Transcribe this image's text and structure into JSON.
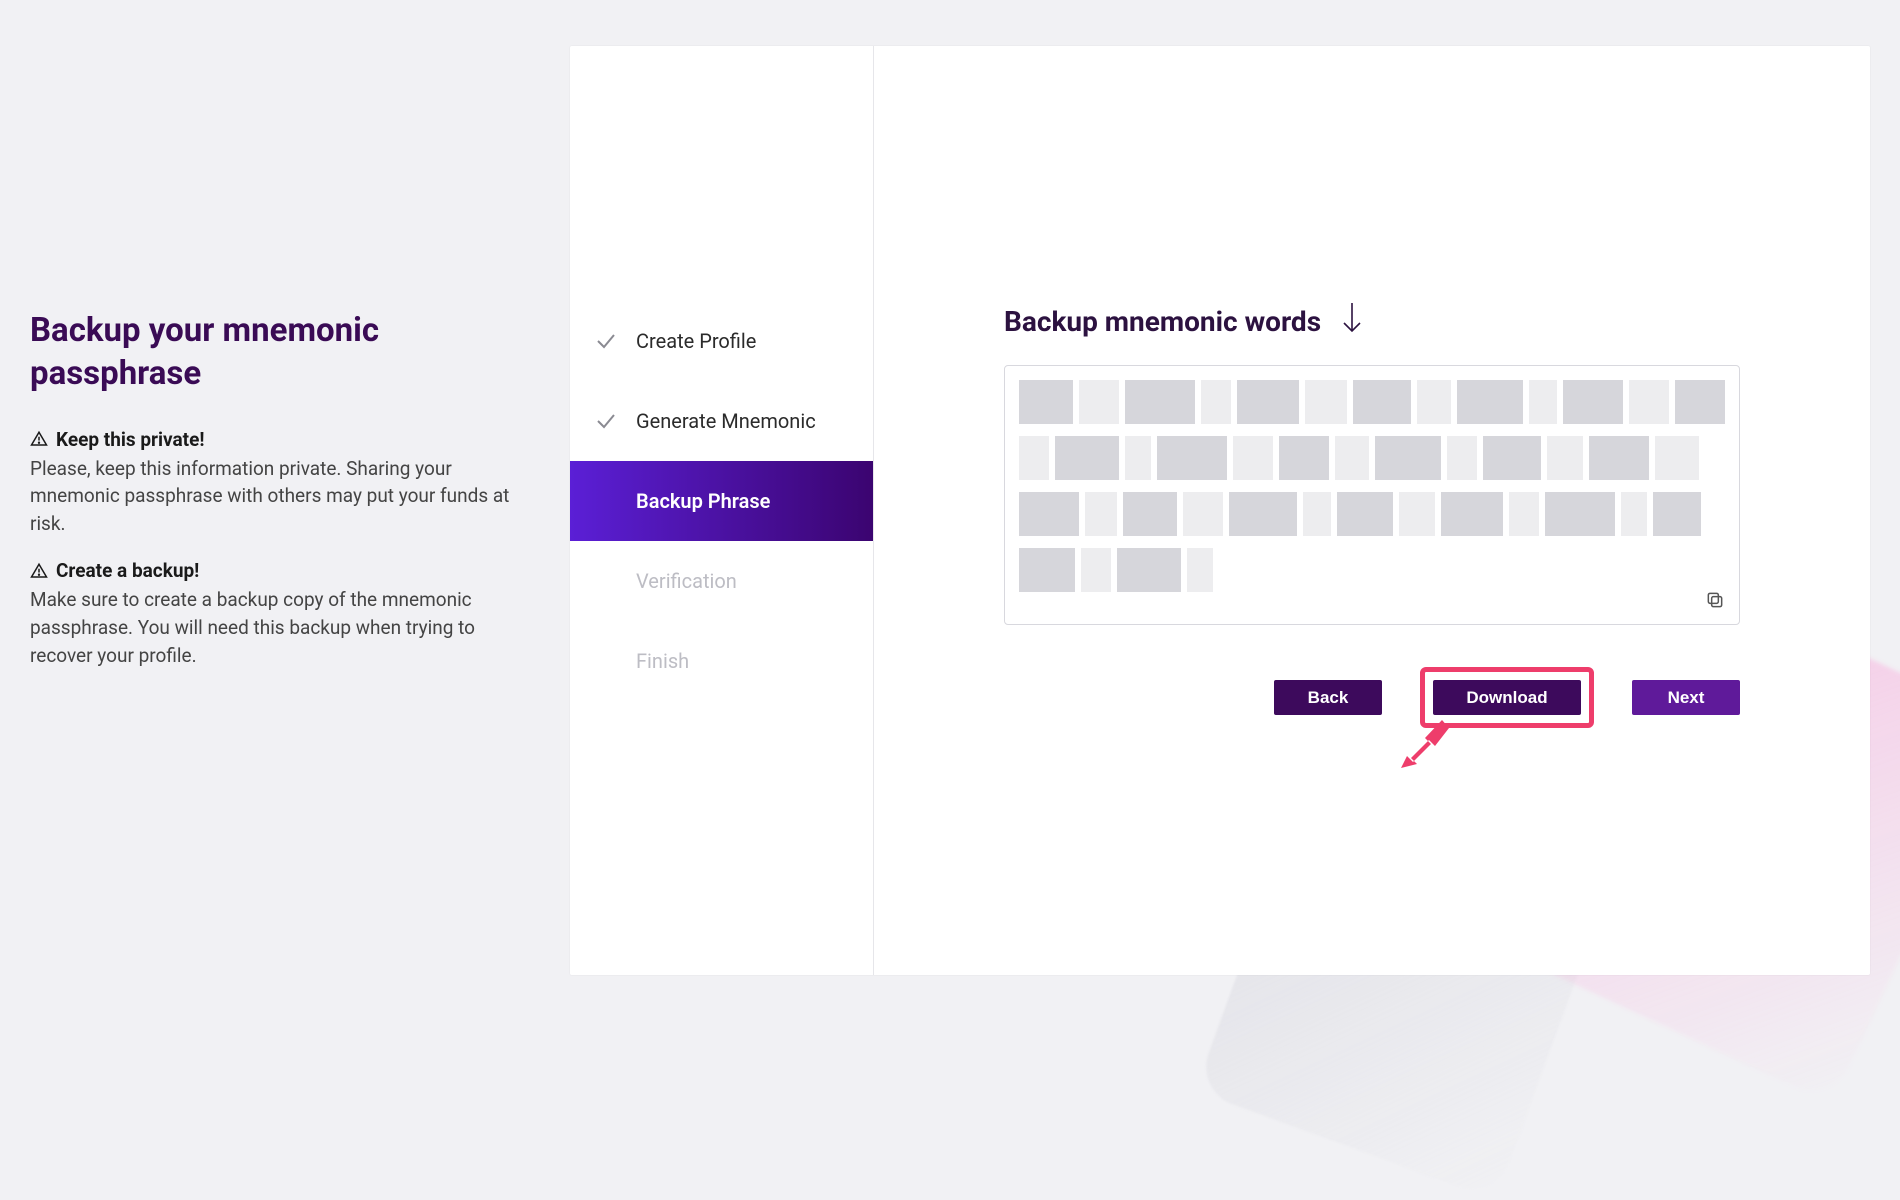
{
  "left": {
    "title": "Backup your mnemonic passphrase",
    "warnings": [
      {
        "head": "Keep this private!",
        "body": "Please, keep this information private. Sharing your mnemonic passphrase with others may put your funds at risk."
      },
      {
        "head": "Create a backup!",
        "body": "Make sure to create a backup copy of the mnemonic passphrase. You will need this backup when trying to recover your profile."
      }
    ]
  },
  "steps": [
    {
      "label": "Create Profile",
      "state": "done"
    },
    {
      "label": "Generate Mnemonic",
      "state": "done"
    },
    {
      "label": "Backup Phrase",
      "state": "active"
    },
    {
      "label": "Verification",
      "state": "pending"
    },
    {
      "label": "Finish",
      "state": "pending"
    }
  ],
  "main": {
    "section_title": "Backup mnemonic words",
    "mnemonic_redacted": true,
    "buttons": {
      "back": "Back",
      "download": "Download",
      "next": "Next"
    },
    "highlighted_button": "download"
  },
  "icons": {
    "warning": "warning-triangle-icon",
    "check": "checkmark-icon",
    "down_arrow": "arrow-down-icon",
    "copy": "copy-icon",
    "pointer": "annotation-arrow-icon"
  }
}
